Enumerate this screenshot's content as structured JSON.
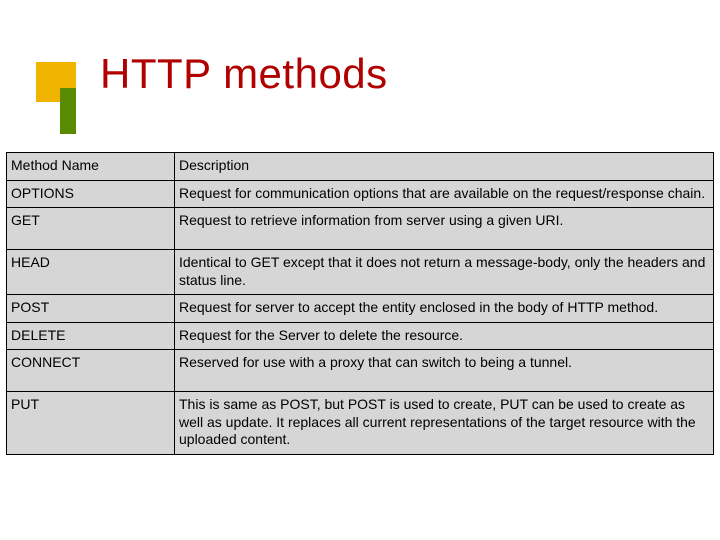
{
  "title": "HTTP methods",
  "table": {
    "headers": {
      "method": "Method Name",
      "desc": "Description"
    },
    "rows": [
      {
        "method": "OPTIONS",
        "desc": "Request for communication options that are available on the request/response chain."
      },
      {
        "method": "GET",
        "desc": "Request to retrieve information from server using a given URI."
      },
      {
        "method": "HEAD",
        "desc": "Identical to GET except that it does not return a message-body, only the headers and status line."
      },
      {
        "method": "POST",
        "desc": "Request for server to accept the entity enclosed in the body of HTTP method."
      },
      {
        "method": "DELETE",
        "desc": "Request for the Server to delete the resource."
      },
      {
        "method": "CONNECT",
        "desc": "Reserved for use with a proxy that can switch to being a tunnel."
      },
      {
        "method": "PUT",
        "desc": "This is same as POST, but POST is used to create, PUT can be used to create as well as update. It replaces all current representations of the target resource with the uploaded content."
      }
    ]
  }
}
